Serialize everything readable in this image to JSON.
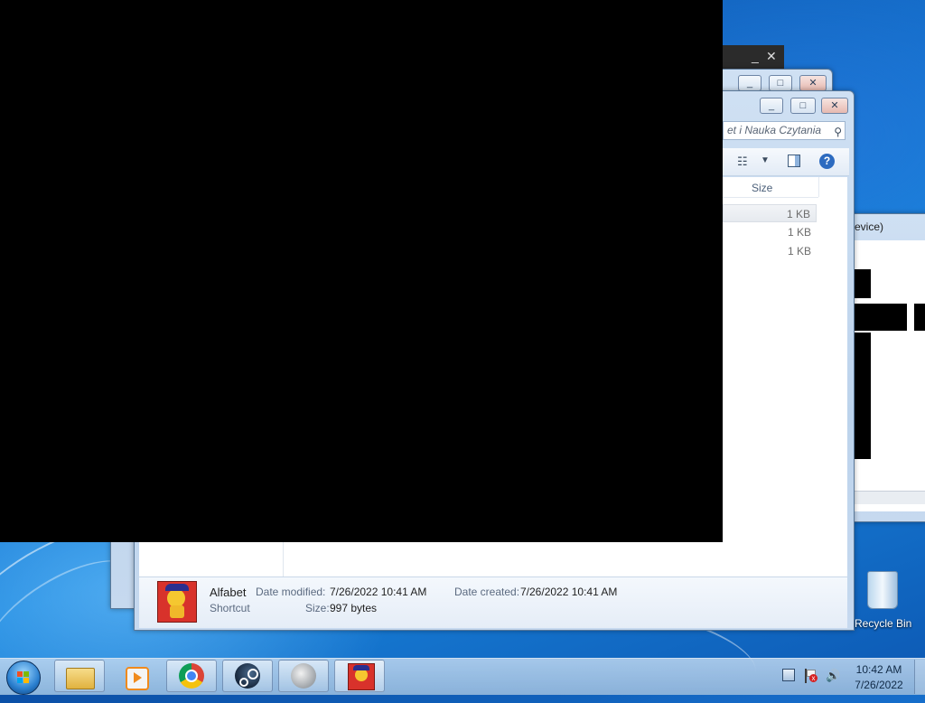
{
  "desktop": {
    "recycle_bin_label": "Recycle Bin"
  },
  "explorer": {
    "search_placeholder": "et i Nauka Czytania",
    "columns": {
      "size": "Size"
    },
    "rows": [
      {
        "size": "1 KB"
      },
      {
        "size": "1 KB"
      },
      {
        "size": "1 KB"
      }
    ],
    "details": {
      "name": "Alfabet",
      "type": "Shortcut",
      "date_modified_label": "Date modified:",
      "date_modified": "7/26/2022 10:41 AM",
      "date_created_label": "Date created:",
      "date_created": "7/26/2022 10:41 AM",
      "size_label": "Size:",
      "size": "997 bytes"
    }
  },
  "right_window": {
    "title_fragment": "evice)"
  },
  "caption_buttons": {
    "minimize": "_",
    "maximize": "□",
    "close": "✕"
  },
  "taskbar": {
    "apps": [
      "explorer",
      "media-player",
      "chrome",
      "steam",
      "volume-app",
      "alfabet"
    ],
    "time": "10:42 AM",
    "date": "7/26/2022"
  }
}
